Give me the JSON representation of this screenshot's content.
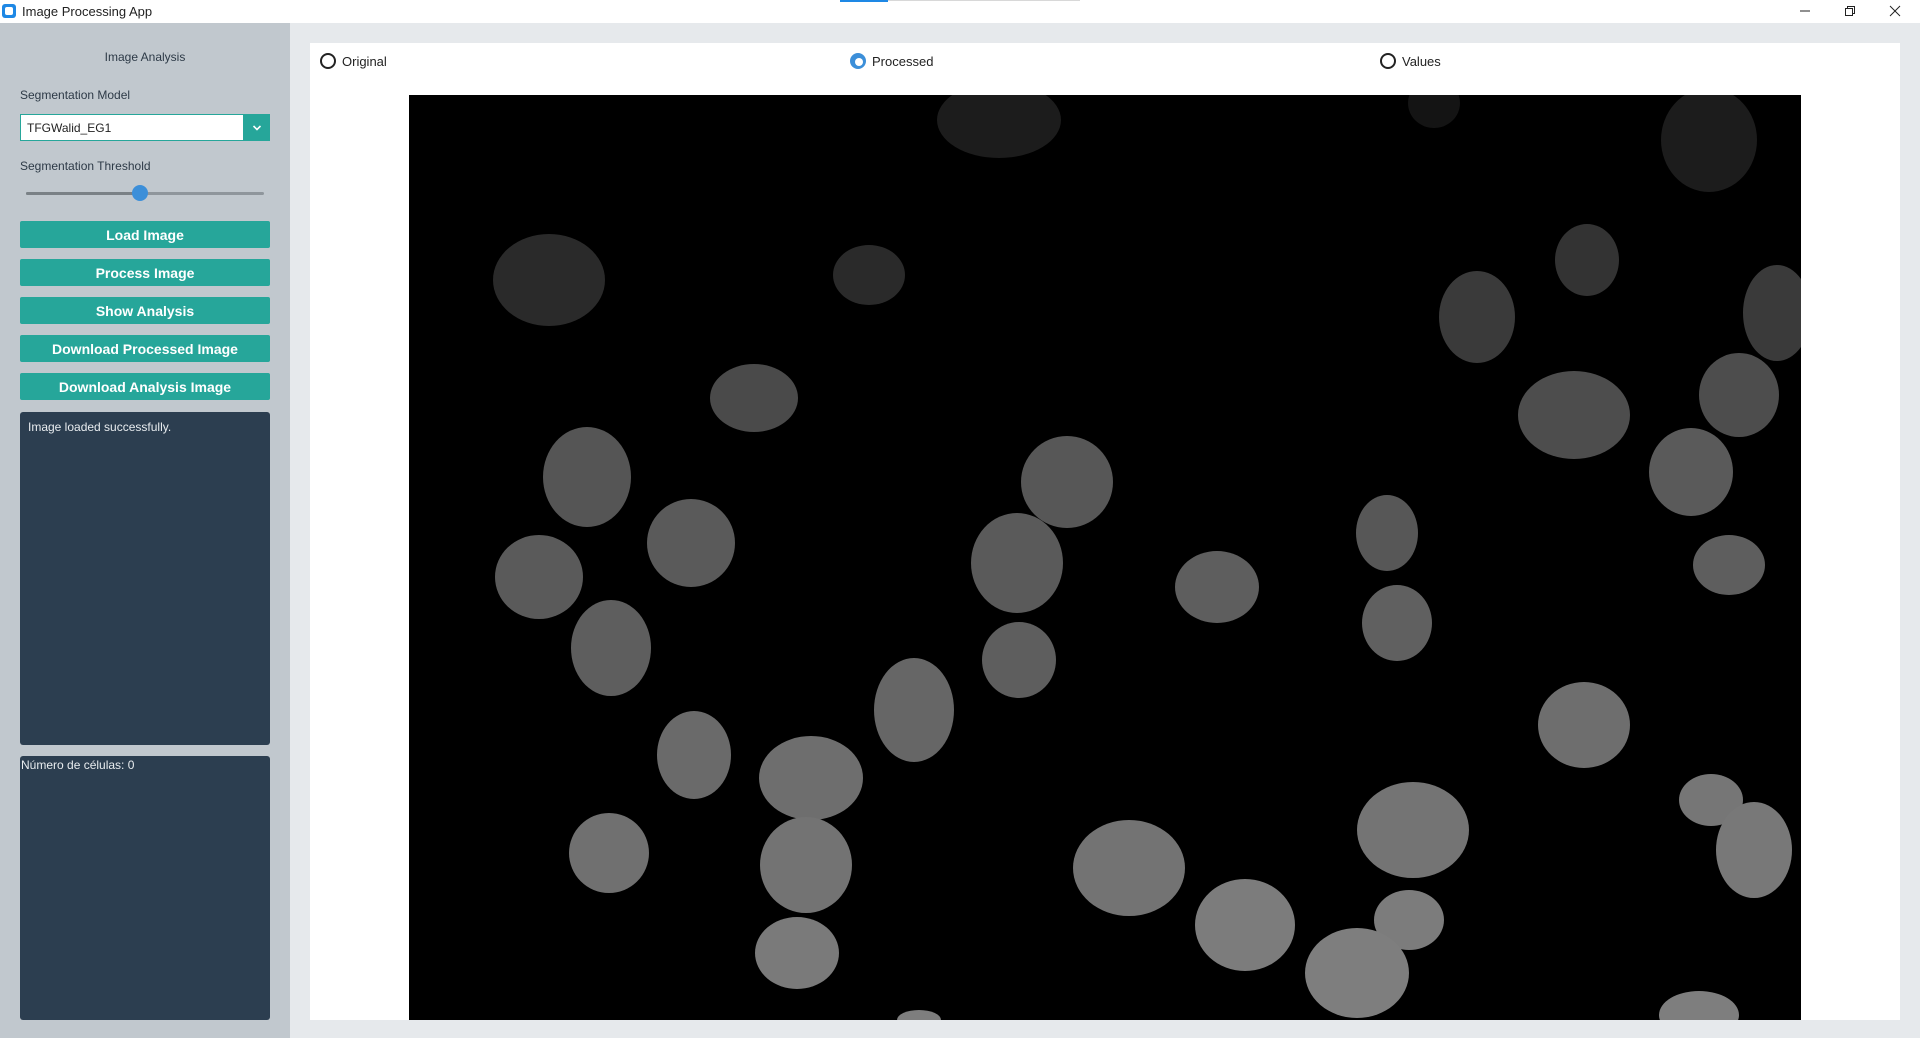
{
  "window": {
    "title": "Image Processing App"
  },
  "sidebar": {
    "title": "Image Analysis",
    "model_label": "Segmentation Model",
    "model_value": "TFGWalid_EG1",
    "threshold_label": "Segmentation Threshold",
    "threshold_value": 0.48,
    "buttons": {
      "load": "Load Image",
      "process": "Process Image",
      "show": "Show Analysis",
      "download_processed": "Download Processed Image",
      "download_analysis": "Download Analysis Image"
    },
    "log_text": "Image loaded successfully.",
    "cell_count_text": "Número de células: 0"
  },
  "view_modes": {
    "original": "Original",
    "processed": "Processed",
    "values": "Values",
    "selected": "processed"
  },
  "colors": {
    "accent": "#26a69a",
    "sidebar_bg": "#c1c8ce",
    "panel_bg": "#2c3e50",
    "radio_selected": "#3c8fd9"
  }
}
